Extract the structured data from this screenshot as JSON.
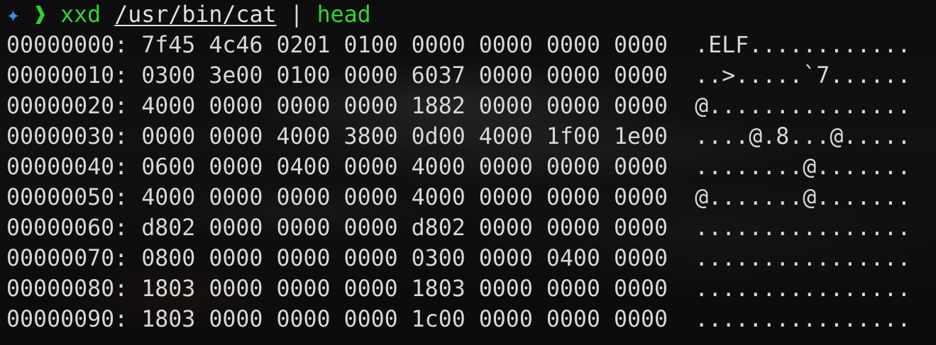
{
  "prompt": {
    "symbol": "✦",
    "arrow": "❱",
    "command": "xxd",
    "path": "/usr/bin/cat",
    "pipe": "|",
    "filter": "head"
  },
  "rows": [
    {
      "offset": "00000000:",
      "hex": "7f45 4c46 0201 0100 0000 0000 0000 0000",
      "ascii": ".ELF............"
    },
    {
      "offset": "00000010:",
      "hex": "0300 3e00 0100 0000 6037 0000 0000 0000",
      "ascii": "..>.....`7......"
    },
    {
      "offset": "00000020:",
      "hex": "4000 0000 0000 0000 1882 0000 0000 0000",
      "ascii": "@..............."
    },
    {
      "offset": "00000030:",
      "hex": "0000 0000 4000 3800 0d00 4000 1f00 1e00",
      "ascii": "....@.8...@....."
    },
    {
      "offset": "00000040:",
      "hex": "0600 0000 0400 0000 4000 0000 0000 0000",
      "ascii": "........@......."
    },
    {
      "offset": "00000050:",
      "hex": "4000 0000 0000 0000 4000 0000 0000 0000",
      "ascii": "@.......@......."
    },
    {
      "offset": "00000060:",
      "hex": "d802 0000 0000 0000 d802 0000 0000 0000",
      "ascii": "................"
    },
    {
      "offset": "00000070:",
      "hex": "0800 0000 0000 0000 0300 0000 0400 0000",
      "ascii": "................"
    },
    {
      "offset": "00000080:",
      "hex": "1803 0000 0000 0000 1803 0000 0000 0000",
      "ascii": "................"
    },
    {
      "offset": "00000090:",
      "hex": "1803 0000 0000 0000 1c00 0000 0000 0000",
      "ascii": "................"
    }
  ]
}
